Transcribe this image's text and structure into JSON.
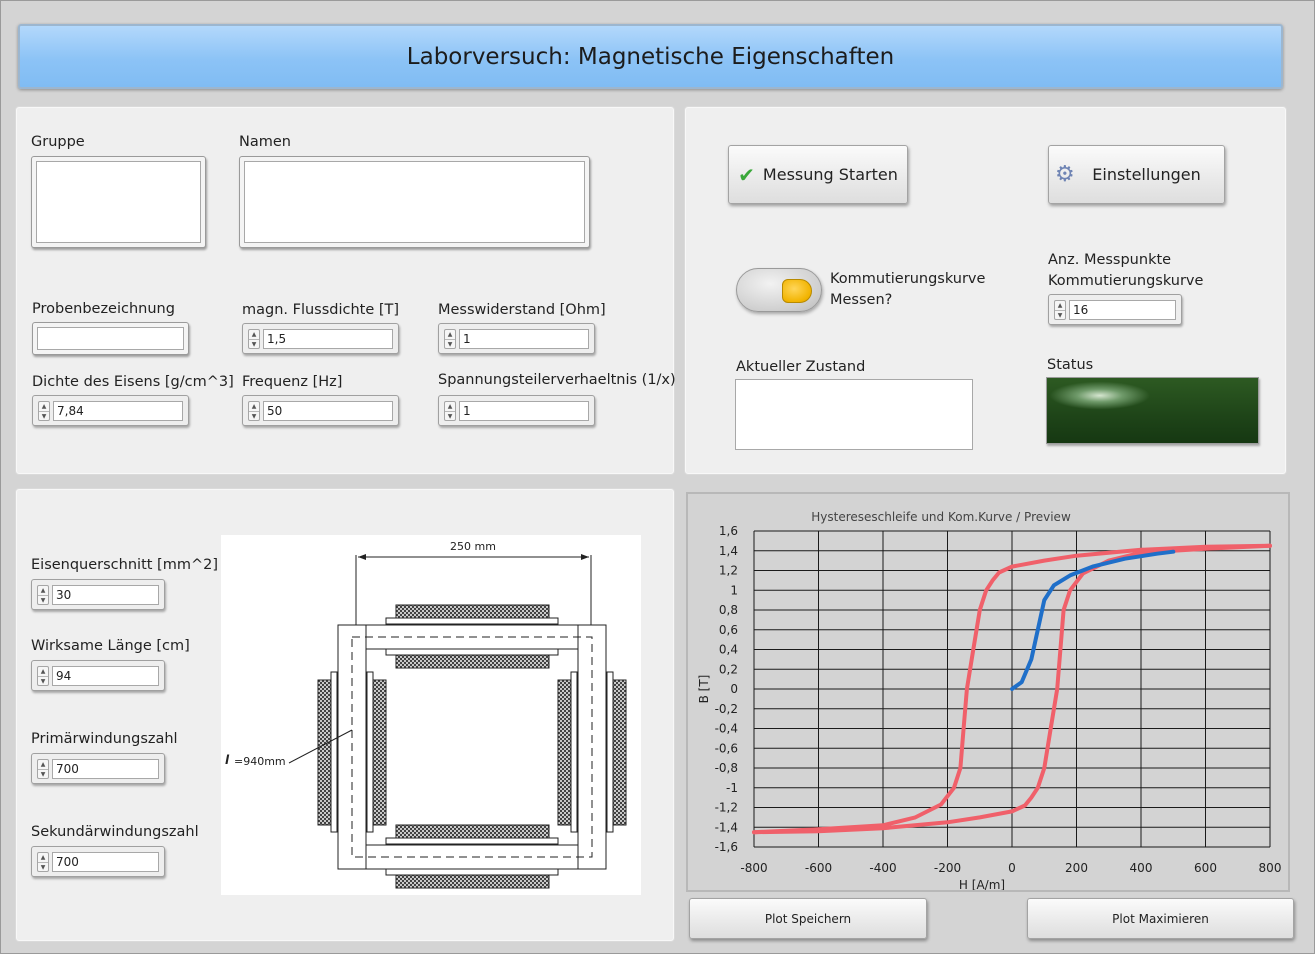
{
  "title": "Laborversuch: Magnetische Eigenschaften",
  "left_top": {
    "gruppe_label": "Gruppe",
    "namen_label": "Namen",
    "proben_label": "Probenbezeichnung",
    "dichte_label": "Dichte des Eisens [g/cm^3]",
    "dichte_value": "7,84",
    "fluss_label": "magn. Flussdichte [T]",
    "fluss_value": "1,5",
    "freq_label": "Frequenz [Hz]",
    "freq_value": "50",
    "messwid_label": "Messwiderstand [Ohm]",
    "messwid_value": "1",
    "spannung_label": "Spannungsteilerverhaeltnis (1/x)",
    "spannung_value": "1"
  },
  "right_top": {
    "start_label": "Messung Starten",
    "settings_label": "Einstellungen",
    "komm_label_1": "Kommutierungskurve",
    "komm_label_2": "Messen?",
    "anz_label_1": "Anz. Messpunkte",
    "anz_label_2": "Kommutierungskurve",
    "anz_value": "16",
    "zustand_label": "Aktueller Zustand",
    "status_label": "Status",
    "status_color": "#1e4418"
  },
  "left_bottom": {
    "querschnitt_label": "Eisenquerschnitt [mm^2]",
    "querschnitt_value": "30",
    "laenge_label": "Wirksame Länge [cm]",
    "laenge_value": "94",
    "primaer_label": "Primärwindungszahl",
    "primaer_value": "700",
    "sekundaer_label": "Sekundärwindungszahl",
    "sekundaer_value": "700",
    "diagram_dim": "250 mm",
    "diagram_lm": "=940mm"
  },
  "buttons": {
    "plot_save": "Plot Speichern",
    "plot_max": "Plot Maximieren"
  },
  "chart_data": {
    "type": "line",
    "title": "Hystereseschleife und Kom.Kurve / Preview",
    "xlabel": "H [A/m]",
    "ylabel": "B [T]",
    "xlim": [
      -800,
      800
    ],
    "ylim": [
      -1.6,
      1.6
    ],
    "x_ticks": [
      "-800",
      "-600",
      "-400",
      "-200",
      "0",
      "200",
      "400",
      "600",
      "800"
    ],
    "y_ticks": [
      "1,6",
      "1,4",
      "1,2",
      "1",
      "0,8",
      "0,6",
      "0,4",
      "0,2",
      "0",
      "-0,2",
      "-0,4",
      "-0,6",
      "-0,8",
      "-1",
      "-1,2",
      "-1,4",
      "-1,6"
    ],
    "grid": true,
    "series": [
      {
        "color": "#f0606a",
        "x": [
          -800,
          -600,
          -400,
          -300,
          -220,
          -180,
          -160,
          -150,
          -140,
          -120,
          -100,
          -80,
          -60,
          -40,
          0,
          100,
          200,
          400,
          600,
          800
        ],
        "y": [
          -1.45,
          -1.42,
          -1.38,
          -1.3,
          -1.17,
          -1.0,
          -0.8,
          -0.4,
          0.0,
          0.4,
          0.8,
          1.0,
          1.1,
          1.18,
          1.24,
          1.3,
          1.35,
          1.41,
          1.44,
          1.45
        ]
      },
      {
        "color": "#f0606a",
        "x": [
          800,
          600,
          400,
          300,
          220,
          180,
          160,
          150,
          140,
          120,
          100,
          80,
          60,
          40,
          0,
          -100,
          -200,
          -400,
          -600,
          -800
        ],
        "y": [
          1.45,
          1.42,
          1.38,
          1.3,
          1.17,
          1.0,
          0.8,
          0.4,
          0.0,
          -0.4,
          -0.8,
          -1.0,
          -1.1,
          -1.18,
          -1.24,
          -1.3,
          -1.35,
          -1.41,
          -1.44,
          -1.45
        ]
      },
      {
        "color": "#1f6fc9",
        "x": [
          0,
          30,
          60,
          80,
          100,
          130,
          180,
          250,
          350,
          450,
          500
        ],
        "y": [
          0.0,
          0.07,
          0.3,
          0.6,
          0.9,
          1.05,
          1.15,
          1.24,
          1.32,
          1.37,
          1.39
        ]
      }
    ]
  }
}
